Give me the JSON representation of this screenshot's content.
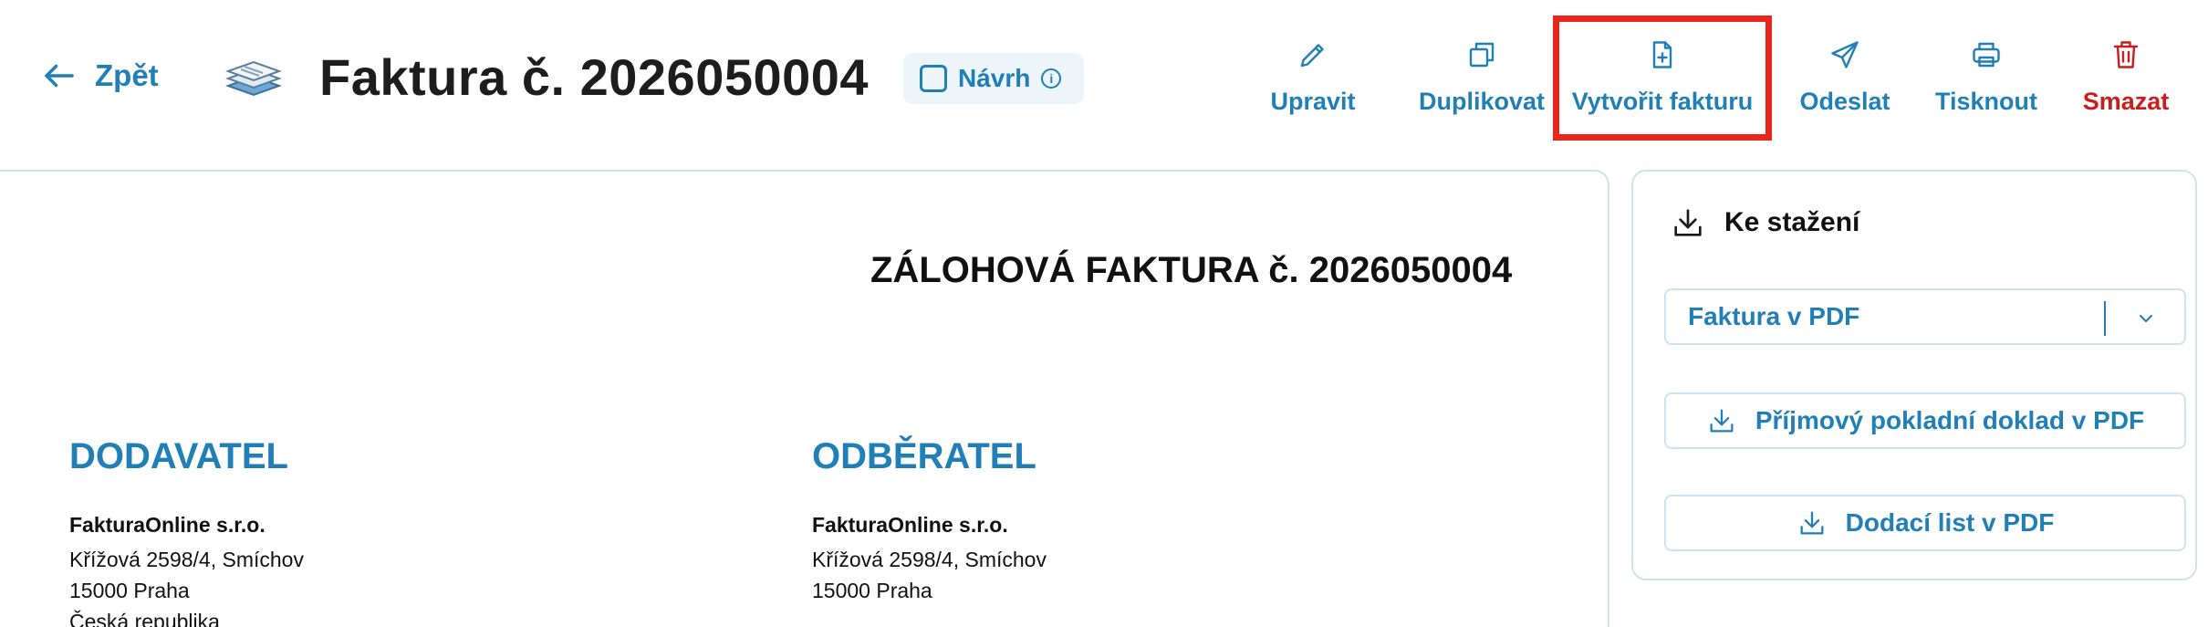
{
  "header": {
    "back_label": "Zpět",
    "title": "Faktura č. 2026050004",
    "status_badge": "Návrh",
    "info_glyph": "i"
  },
  "actions": [
    {
      "label": "Upravit",
      "icon": "pencil-icon"
    },
    {
      "label": "Duplikovat",
      "icon": "duplicate-icon"
    },
    {
      "label": "Vytvořit fakturu",
      "icon": "file-plus-icon"
    },
    {
      "label": "Odeslat",
      "icon": "send-icon"
    },
    {
      "label": "Tisknout",
      "icon": "printer-icon"
    },
    {
      "label": "Smazat",
      "icon": "trash-icon"
    }
  ],
  "invoice": {
    "heading": "ZÁLOHOVÁ FAKTURA č. 2026050004",
    "supplier": {
      "label": "DODAVATEL",
      "name": "FakturaOnline s.r.o.",
      "street": "Křížová 2598/4, Smíchov",
      "city": "15000 Praha",
      "country": "Česká republika"
    },
    "customer": {
      "label": "ODBĚRATEL",
      "name": "FakturaOnline s.r.o.",
      "street": "Křížová 2598/4, Smíchov",
      "city": "15000 Praha"
    }
  },
  "downloads": {
    "heading": "Ke stažení",
    "format_select": "Faktura v PDF",
    "receipt_button": "Příjmový pokladní doklad v PDF",
    "delivery_button": "Dodací list v PDF"
  },
  "colors": {
    "accent": "#1f7fb6",
    "danger": "#c81e1e",
    "highlight": "#e8261c",
    "border": "#cfe3ef"
  }
}
